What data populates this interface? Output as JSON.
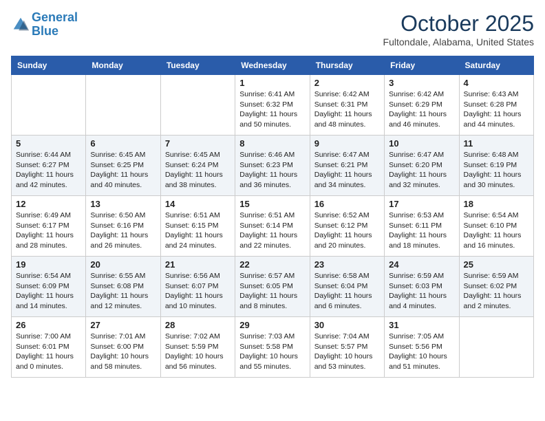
{
  "logo": {
    "line1": "General",
    "line2": "Blue"
  },
  "title": "October 2025",
  "location": "Fultondale, Alabama, United States",
  "weekdays": [
    "Sunday",
    "Monday",
    "Tuesday",
    "Wednesday",
    "Thursday",
    "Friday",
    "Saturday"
  ],
  "weeks": [
    [
      {
        "day": "",
        "text": ""
      },
      {
        "day": "",
        "text": ""
      },
      {
        "day": "",
        "text": ""
      },
      {
        "day": "1",
        "text": "Sunrise: 6:41 AM\nSunset: 6:32 PM\nDaylight: 11 hours\nand 50 minutes."
      },
      {
        "day": "2",
        "text": "Sunrise: 6:42 AM\nSunset: 6:31 PM\nDaylight: 11 hours\nand 48 minutes."
      },
      {
        "day": "3",
        "text": "Sunrise: 6:42 AM\nSunset: 6:29 PM\nDaylight: 11 hours\nand 46 minutes."
      },
      {
        "day": "4",
        "text": "Sunrise: 6:43 AM\nSunset: 6:28 PM\nDaylight: 11 hours\nand 44 minutes."
      }
    ],
    [
      {
        "day": "5",
        "text": "Sunrise: 6:44 AM\nSunset: 6:27 PM\nDaylight: 11 hours\nand 42 minutes."
      },
      {
        "day": "6",
        "text": "Sunrise: 6:45 AM\nSunset: 6:25 PM\nDaylight: 11 hours\nand 40 minutes."
      },
      {
        "day": "7",
        "text": "Sunrise: 6:45 AM\nSunset: 6:24 PM\nDaylight: 11 hours\nand 38 minutes."
      },
      {
        "day": "8",
        "text": "Sunrise: 6:46 AM\nSunset: 6:23 PM\nDaylight: 11 hours\nand 36 minutes."
      },
      {
        "day": "9",
        "text": "Sunrise: 6:47 AM\nSunset: 6:21 PM\nDaylight: 11 hours\nand 34 minutes."
      },
      {
        "day": "10",
        "text": "Sunrise: 6:47 AM\nSunset: 6:20 PM\nDaylight: 11 hours\nand 32 minutes."
      },
      {
        "day": "11",
        "text": "Sunrise: 6:48 AM\nSunset: 6:19 PM\nDaylight: 11 hours\nand 30 minutes."
      }
    ],
    [
      {
        "day": "12",
        "text": "Sunrise: 6:49 AM\nSunset: 6:17 PM\nDaylight: 11 hours\nand 28 minutes."
      },
      {
        "day": "13",
        "text": "Sunrise: 6:50 AM\nSunset: 6:16 PM\nDaylight: 11 hours\nand 26 minutes."
      },
      {
        "day": "14",
        "text": "Sunrise: 6:51 AM\nSunset: 6:15 PM\nDaylight: 11 hours\nand 24 minutes."
      },
      {
        "day": "15",
        "text": "Sunrise: 6:51 AM\nSunset: 6:14 PM\nDaylight: 11 hours\nand 22 minutes."
      },
      {
        "day": "16",
        "text": "Sunrise: 6:52 AM\nSunset: 6:12 PM\nDaylight: 11 hours\nand 20 minutes."
      },
      {
        "day": "17",
        "text": "Sunrise: 6:53 AM\nSunset: 6:11 PM\nDaylight: 11 hours\nand 18 minutes."
      },
      {
        "day": "18",
        "text": "Sunrise: 6:54 AM\nSunset: 6:10 PM\nDaylight: 11 hours\nand 16 minutes."
      }
    ],
    [
      {
        "day": "19",
        "text": "Sunrise: 6:54 AM\nSunset: 6:09 PM\nDaylight: 11 hours\nand 14 minutes."
      },
      {
        "day": "20",
        "text": "Sunrise: 6:55 AM\nSunset: 6:08 PM\nDaylight: 11 hours\nand 12 minutes."
      },
      {
        "day": "21",
        "text": "Sunrise: 6:56 AM\nSunset: 6:07 PM\nDaylight: 11 hours\nand 10 minutes."
      },
      {
        "day": "22",
        "text": "Sunrise: 6:57 AM\nSunset: 6:05 PM\nDaylight: 11 hours\nand 8 minutes."
      },
      {
        "day": "23",
        "text": "Sunrise: 6:58 AM\nSunset: 6:04 PM\nDaylight: 11 hours\nand 6 minutes."
      },
      {
        "day": "24",
        "text": "Sunrise: 6:59 AM\nSunset: 6:03 PM\nDaylight: 11 hours\nand 4 minutes."
      },
      {
        "day": "25",
        "text": "Sunrise: 6:59 AM\nSunset: 6:02 PM\nDaylight: 11 hours\nand 2 minutes."
      }
    ],
    [
      {
        "day": "26",
        "text": "Sunrise: 7:00 AM\nSunset: 6:01 PM\nDaylight: 11 hours\nand 0 minutes."
      },
      {
        "day": "27",
        "text": "Sunrise: 7:01 AM\nSunset: 6:00 PM\nDaylight: 10 hours\nand 58 minutes."
      },
      {
        "day": "28",
        "text": "Sunrise: 7:02 AM\nSunset: 5:59 PM\nDaylight: 10 hours\nand 56 minutes."
      },
      {
        "day": "29",
        "text": "Sunrise: 7:03 AM\nSunset: 5:58 PM\nDaylight: 10 hours\nand 55 minutes."
      },
      {
        "day": "30",
        "text": "Sunrise: 7:04 AM\nSunset: 5:57 PM\nDaylight: 10 hours\nand 53 minutes."
      },
      {
        "day": "31",
        "text": "Sunrise: 7:05 AM\nSunset: 5:56 PM\nDaylight: 10 hours\nand 51 minutes."
      },
      {
        "day": "",
        "text": ""
      }
    ]
  ]
}
